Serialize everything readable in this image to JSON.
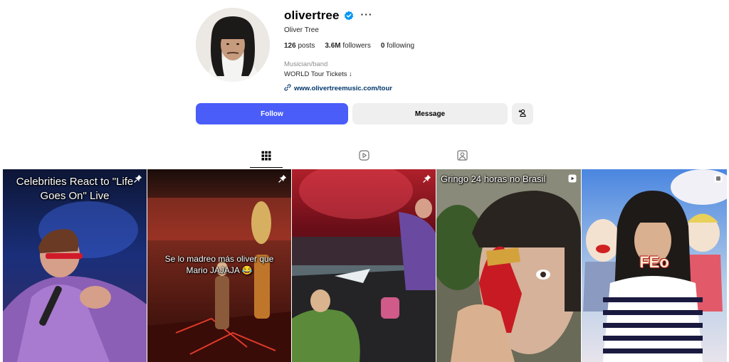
{
  "profile": {
    "username": "olivertree",
    "full_name": "Oliver Tree",
    "stats": {
      "posts_count": "126",
      "posts_label": "posts",
      "followers_count": "3.6M",
      "followers_label": "followers",
      "following_count": "0",
      "following_label": "following"
    },
    "category": "Musician/band",
    "bio": "WORLD Tour Tickets ↓",
    "link": "www.olivertreemusic.com/tour",
    "verified": true,
    "more_icon": "ellipsis-icon"
  },
  "actions": {
    "follow_label": "Follow",
    "message_label": "Message",
    "suggest_icon": "add-person-icon"
  },
  "tabs": [
    {
      "icon": "grid-icon",
      "active": true
    },
    {
      "icon": "reels-icon",
      "active": false
    },
    {
      "icon": "tagged-icon",
      "active": false
    }
  ],
  "posts": [
    {
      "caption": "Celebrities React to \"Life Goes On\" Live",
      "pinned": true
    },
    {
      "caption": "Se lo madreo más oliver que Mario JAJAJA 😂",
      "pinned": true
    },
    {
      "caption": "",
      "pinned": true
    },
    {
      "caption": "Gringo 24 horas no Brasil",
      "pinned": false,
      "type": "reel"
    },
    {
      "caption": "FEo",
      "pinned": false,
      "type": "clip"
    }
  ],
  "colors": {
    "follow_button": "#4a5df9",
    "secondary_button": "#efefef",
    "verified_badge": "#0095f6",
    "link": "#00376b"
  }
}
